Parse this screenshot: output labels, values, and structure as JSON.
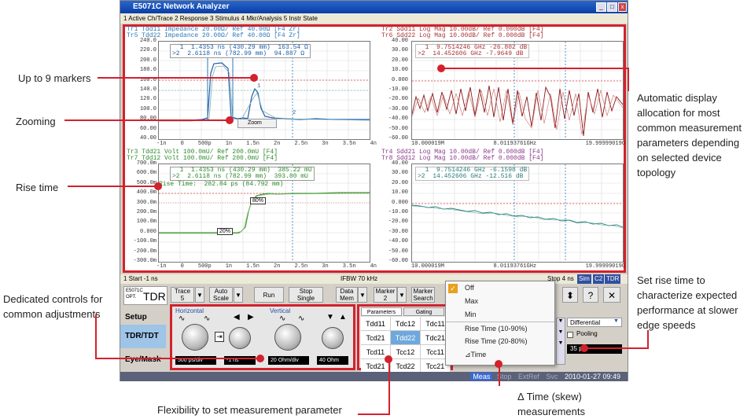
{
  "callouts": {
    "markers": "Up to 9 markers",
    "zooming": "Zooming",
    "rise_time": "Rise time",
    "dedicated": "Dedicated controls for common adjustments",
    "flexibility": "Flexibility to set measurement parameter",
    "auto_display": "Automatic display allocation for most common measurement parameters depending on selected device topology",
    "set_rise": "Set rise time to characterize expected performance at slower edge speeds",
    "delta_time": "Δ Time (skew) measurements"
  },
  "window": {
    "title": "E5071C Network Analyzer",
    "menu": "1 Active Ch/Trace   2 Response   3 Stimulus   4 Mkr/Analysis   5 Instr State"
  },
  "plot_tl": {
    "hdr1": "Tr1 Tdd11 Impedance 20.00Ω/ Ref 40.00Ω [F4 Zr]",
    "hdr2": "Tr5 Tdd22 Impedance 20.00Ω/ Ref 40.00Ω [F4 Zr]",
    "m1": "  1  1.4353 ns (430.29 mm)  163.54 Ω",
    "m2": ">2  2.6118 ns (782.99 mm)  94.887 Ω",
    "zoom_label": "Zoom",
    "yticks": [
      "240.0",
      "220.0",
      "200.0",
      "180.0",
      "160.0",
      "140.0",
      "120.0",
      "100.0",
      "80.00",
      "60.00",
      "40.00"
    ],
    "xticks": [
      "-1n",
      "0",
      "500p",
      "1n",
      "1.5n",
      "2n",
      "2.5n",
      "3n",
      "3.5n",
      "4n"
    ]
  },
  "plot_tr": {
    "hdr1": "Tr2 Sdd11 Log Mag 10.00dB/ Ref 0.000dB [F4]",
    "hdr2": "Tr6 Sdd22 Log Mag 10.00dB/ Ref 0.000dB [F4]",
    "m1": "  1  9.7514246 GHz -26.802 dB",
    "m2": ">2  14.452606 GHz -7.9649 dB",
    "yticks": [
      "40.00",
      "30.00",
      "20.00",
      "10.00",
      "0.000",
      "-10.00",
      "-20.00",
      "-30.00",
      "-40.00",
      "-50.00",
      "-60.00"
    ],
    "xticks": [
      "10.000019M",
      "8.01193761GHz",
      "19.99999019G"
    ]
  },
  "plot_bl": {
    "hdr1": "Tr3 Tdd21 Volt 100.0mU/ Ref 200.0mU [F4]",
    "hdr2": "Tr7 Tdd12 Volt 100.0mU/ Ref 200.0mU [F4]",
    "m1": "  1  1.4353 ns (430.29 mm)  385.22 mU",
    "m2": ">2  2.6118 ns (782.99 mm)  393.80 mU",
    "rise": "Rise Time:  282.84 ps (84.792 mm)",
    "pct80": "80%",
    "pct20": "20%",
    "yticks": [
      "700.0m",
      "600.0m",
      "500.0m",
      "400.0m",
      "300.0m",
      "200.0m",
      "100.0m",
      "0.000",
      "-100.0m",
      "-200.0m",
      "-300.0m"
    ],
    "xticks": [
      "-1n",
      "0",
      "500p",
      "1n",
      "1.5n",
      "2n",
      "2.5n",
      "3n",
      "3.5n",
      "4n"
    ]
  },
  "plot_br": {
    "hdr1": "Tr4 Sdd21 Log Mag 10.00dB/ Ref 0.000dB [F4]",
    "hdr2": "Tr8 Sdd12 Log Mag 10.00dB/ Ref 0.000dB [F4]",
    "m1": "  1  9.7514246 GHz -6.1598 dB",
    "m2": ">2  14.452606 GHz -12.516 dB",
    "yticks": [
      "40.00",
      "30.00",
      "20.00",
      "10.00",
      "0.000",
      "-10.00",
      "-20.00",
      "-30.00",
      "-40.00",
      "-50.00",
      "-60.00"
    ],
    "xticks": [
      "10.000019M",
      "8.01193761GHz",
      "19.99999019G"
    ]
  },
  "status": {
    "start": "1  Start -1 ns",
    "ifbw": "IFBW 70 kHz",
    "stop": "Stop 4 ns",
    "sim": "Sim",
    "c2": "C2",
    "tdr": "TDR"
  },
  "softkeys": {
    "logo1": "E5071C",
    "logo2": "OPT.",
    "logo_main": "TDR",
    "trace": "Trace",
    "trace_val": "5",
    "autoscale": "Auto",
    "autoscale2": "Scale",
    "run": "Run",
    "stop": "Stop",
    "stop2": "Single",
    "data": "Data",
    "data2": "Mem",
    "marker": "Marker",
    "marker2": "2",
    "msearch": "Marker",
    "msearch2": "Search"
  },
  "side_tabs": [
    "Setup",
    "TDR/TDT",
    "Eye/Mask"
  ],
  "horizontal": {
    "title": "Horizontal",
    "val1": "500 ps/div",
    "val2": "-1 ns"
  },
  "vertical": {
    "title": "Vertical",
    "val1": "20 Ohm/div",
    "val2": "40 Ohm"
  },
  "param_tabs": {
    "t1": "Parameters",
    "t2": "Gating"
  },
  "param_grid": [
    [
      "Tdd11",
      "Tdc12",
      "Tdc11"
    ],
    [
      "Tcd21",
      "Tdd22",
      "Tdc21"
    ],
    [
      "Tcd11",
      "Tcc12",
      "Tcc11"
    ],
    [
      "Tcd21",
      "Tcd22",
      "Tcc21"
    ]
  ],
  "dropdown_menu": [
    "Off",
    "Max",
    "Min",
    "Rise Time (10-90%)",
    "Rise Time (20-80%)",
    "⊿Time"
  ],
  "right_panel": {
    "mode": "Differential",
    "pooling": "Pooling",
    "rise_val": "35 ps",
    "help": "?",
    "close": "✕"
  },
  "bottom_status": {
    "meas": "Meas",
    "stop": "Stop",
    "extref": "ExtRef",
    "svc": "Svc",
    "datetime": "2010-01-27 09:49"
  }
}
